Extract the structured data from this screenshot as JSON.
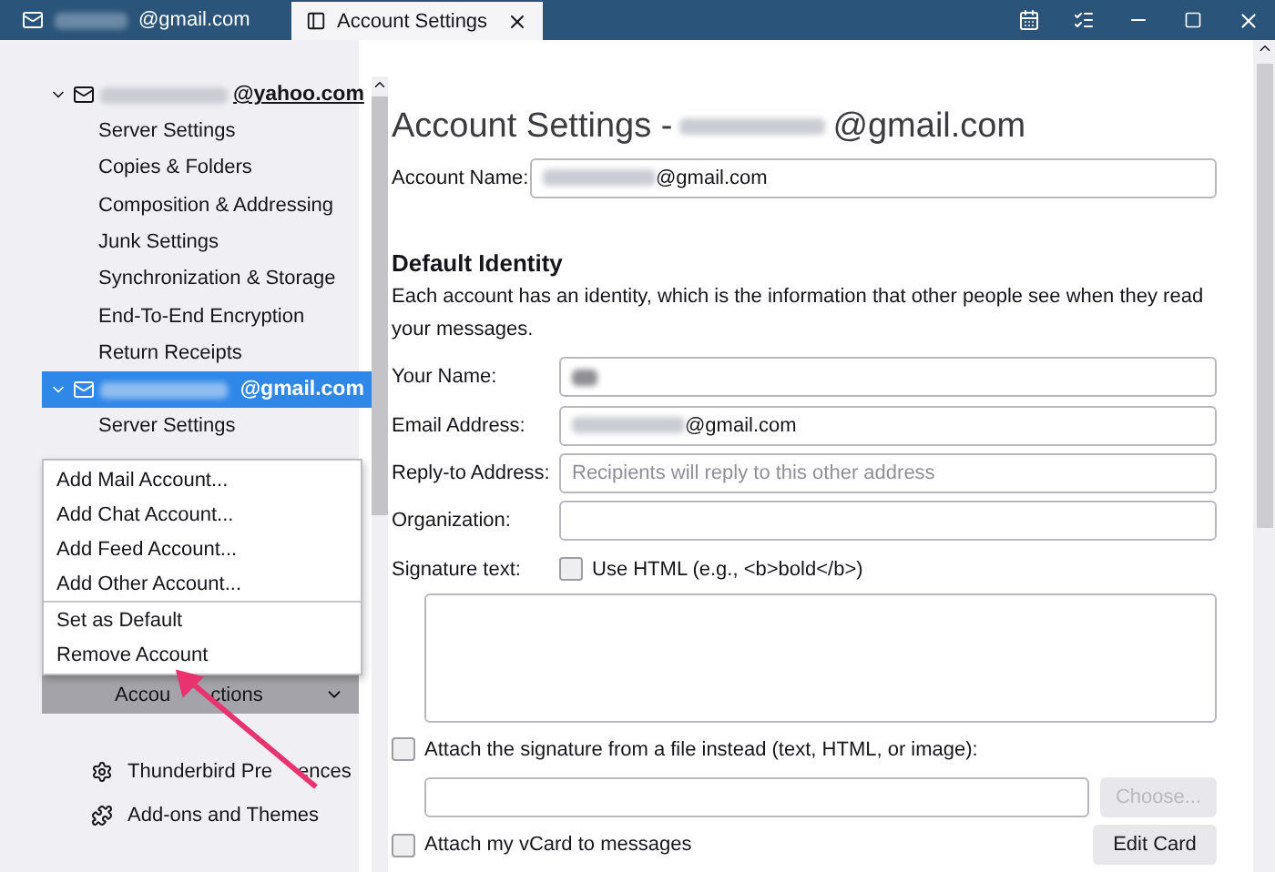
{
  "window": {
    "tabs": [
      {
        "label": "@gmail.com",
        "selected": false,
        "redacted": true
      },
      {
        "label": "Account Settings",
        "selected": true
      }
    ]
  },
  "sidebar": {
    "accounts": [
      {
        "label": "@yahoo.com",
        "redacted": true,
        "expanded": true,
        "selected": false,
        "children": [
          {
            "label": "Server Settings"
          },
          {
            "label": "Copies & Folders"
          },
          {
            "label": "Composition & Addressing"
          },
          {
            "label": "Junk Settings"
          },
          {
            "label": "Synchronization & Storage"
          },
          {
            "label": "End-To-End Encryption"
          },
          {
            "label": "Return Receipts"
          }
        ]
      },
      {
        "label": "@gmail.com",
        "redacted": true,
        "expanded": true,
        "selected": true,
        "children": [
          {
            "label": "Server Settings"
          }
        ]
      }
    ],
    "menu": {
      "groups": [
        [
          {
            "label": "Add Mail Account..."
          },
          {
            "label": "Add Chat Account..."
          },
          {
            "label": "Add Feed Account..."
          },
          {
            "label": "Add Other Account..."
          }
        ],
        [
          {
            "label": "Set as Default"
          },
          {
            "label": "Remove Account"
          }
        ]
      ]
    },
    "account_actions": {
      "label_parts": [
        "Accou",
        "ctions"
      ]
    },
    "links": [
      {
        "label_parts": [
          "Thunderbird Pre",
          "ences"
        ],
        "kind": "gear"
      },
      {
        "label_parts": [
          "Add-ons and Themes"
        ],
        "kind": "puzzle"
      }
    ]
  },
  "main": {
    "title": "Account Settings - ",
    "title_suffix": "@gmail.com",
    "title_redacted": true,
    "account_name": {
      "label": "Account Name:",
      "value": "@gmail.com",
      "redacted": true
    },
    "section": "Default Identity",
    "description": "Each account has an identity, which is the information that other people see when they read your messages.",
    "fields": [
      {
        "label": "Your Name:",
        "redacted": true
      },
      {
        "label": "Email Address:",
        "value": "@gmail.com",
        "redacted": true
      },
      {
        "label": "Reply-to Address:",
        "placeholder": "Recipients will reply to this other address"
      },
      {
        "label": "Organization:"
      }
    ],
    "signature": {
      "label": "Signature text:",
      "use_html": {
        "label": "Use HTML (e.g., <b>bold</b>)",
        "checked": false
      }
    },
    "attach_file": {
      "label": "Attach the signature from a file instead (text, HTML, or image):",
      "checked": false
    },
    "choose_button": {
      "label": "Choose...",
      "disabled": true
    },
    "vcard": {
      "label": "Attach my vCard to messages",
      "checked": false
    },
    "edit_card": {
      "label": "Edit Card"
    }
  }
}
